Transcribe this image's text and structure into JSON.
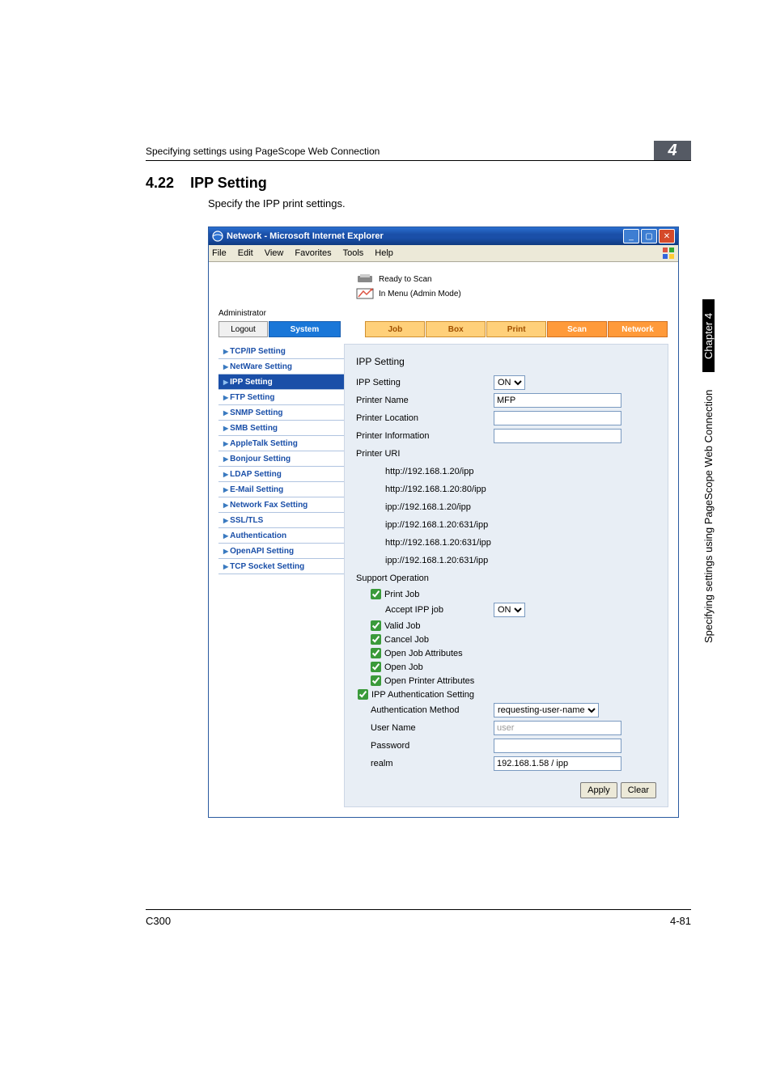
{
  "page": {
    "breadcrumb": "Specifying settings using PageScope Web Connection",
    "chapter_num": "4",
    "heading_num": "4.22",
    "heading_text": "IPP Setting",
    "subtext": "Specify the IPP print settings.",
    "footer_left": "C300",
    "footer_right": "4-81"
  },
  "side_tab": {
    "black": "Chapter 4",
    "text": "Specifying settings using PageScope Web Connection"
  },
  "ie": {
    "title": "Network - Microsoft Internet Explorer",
    "menu": [
      "File",
      "Edit",
      "View",
      "Favorites",
      "Tools",
      "Help"
    ]
  },
  "status": {
    "ready": "Ready to Scan",
    "menu": "In Menu (Admin Mode)"
  },
  "admin_label": "Administrator",
  "tabs": {
    "logout": "Logout",
    "system": "System",
    "job": "Job",
    "box": "Box",
    "print": "Print",
    "scan": "Scan",
    "network": "Network"
  },
  "sidebar": {
    "items": [
      {
        "label": "TCP/IP Setting",
        "selected": false
      },
      {
        "label": "NetWare Setting",
        "selected": false
      },
      {
        "label": "IPP Setting",
        "selected": true
      },
      {
        "label": "FTP Setting",
        "selected": false
      },
      {
        "label": "SNMP Setting",
        "selected": false
      },
      {
        "label": "SMB Setting",
        "selected": false
      },
      {
        "label": "AppleTalk Setting",
        "selected": false
      },
      {
        "label": "Bonjour Setting",
        "selected": false
      },
      {
        "label": "LDAP Setting",
        "selected": false
      },
      {
        "label": "E-Mail Setting",
        "selected": false
      },
      {
        "label": "Network Fax Setting",
        "selected": false
      },
      {
        "label": "SSL/TLS",
        "selected": false
      },
      {
        "label": "Authentication",
        "selected": false
      },
      {
        "label": "OpenAPI Setting",
        "selected": false
      },
      {
        "label": "TCP Socket Setting",
        "selected": false
      }
    ]
  },
  "form": {
    "heading": "IPP Setting",
    "ipp_setting_lbl": "IPP Setting",
    "ipp_setting_val": "ON",
    "printer_name_lbl": "Printer Name",
    "printer_name_val": "MFP",
    "printer_location_lbl": "Printer Location",
    "printer_location_val": "",
    "printer_info_lbl": "Printer Information",
    "printer_info_val": "",
    "printer_uri_lbl": "Printer URI",
    "uris": [
      "http://192.168.1.20/ipp",
      "http://192.168.1.20:80/ipp",
      "ipp://192.168.1.20/ipp",
      "ipp://192.168.1.20:631/ipp",
      "http://192.168.1.20:631/ipp",
      "ipp://192.168.1.20:631/ipp"
    ],
    "support_op_lbl": "Support Operation",
    "print_job_lbl": "Print Job",
    "accept_ipp_lbl": "Accept IPP job",
    "accept_ipp_val": "ON",
    "valid_job_lbl": "Valid Job",
    "cancel_job_lbl": "Cancel Job",
    "open_job_attr_lbl": "Open Job Attributes",
    "open_job_lbl": "Open Job",
    "open_printer_attr_lbl": "Open Printer Attributes",
    "ipp_auth_lbl": "IPP Authentication Setting",
    "auth_method_lbl": "Authentication Method",
    "auth_method_val": "requesting-user-name",
    "user_name_lbl": "User Name",
    "user_name_placeholder": "user",
    "password_lbl": "Password",
    "password_val": "",
    "realm_lbl": "realm",
    "realm_val": "192.168.1.58 / ipp",
    "apply_btn": "Apply",
    "clear_btn": "Clear"
  }
}
